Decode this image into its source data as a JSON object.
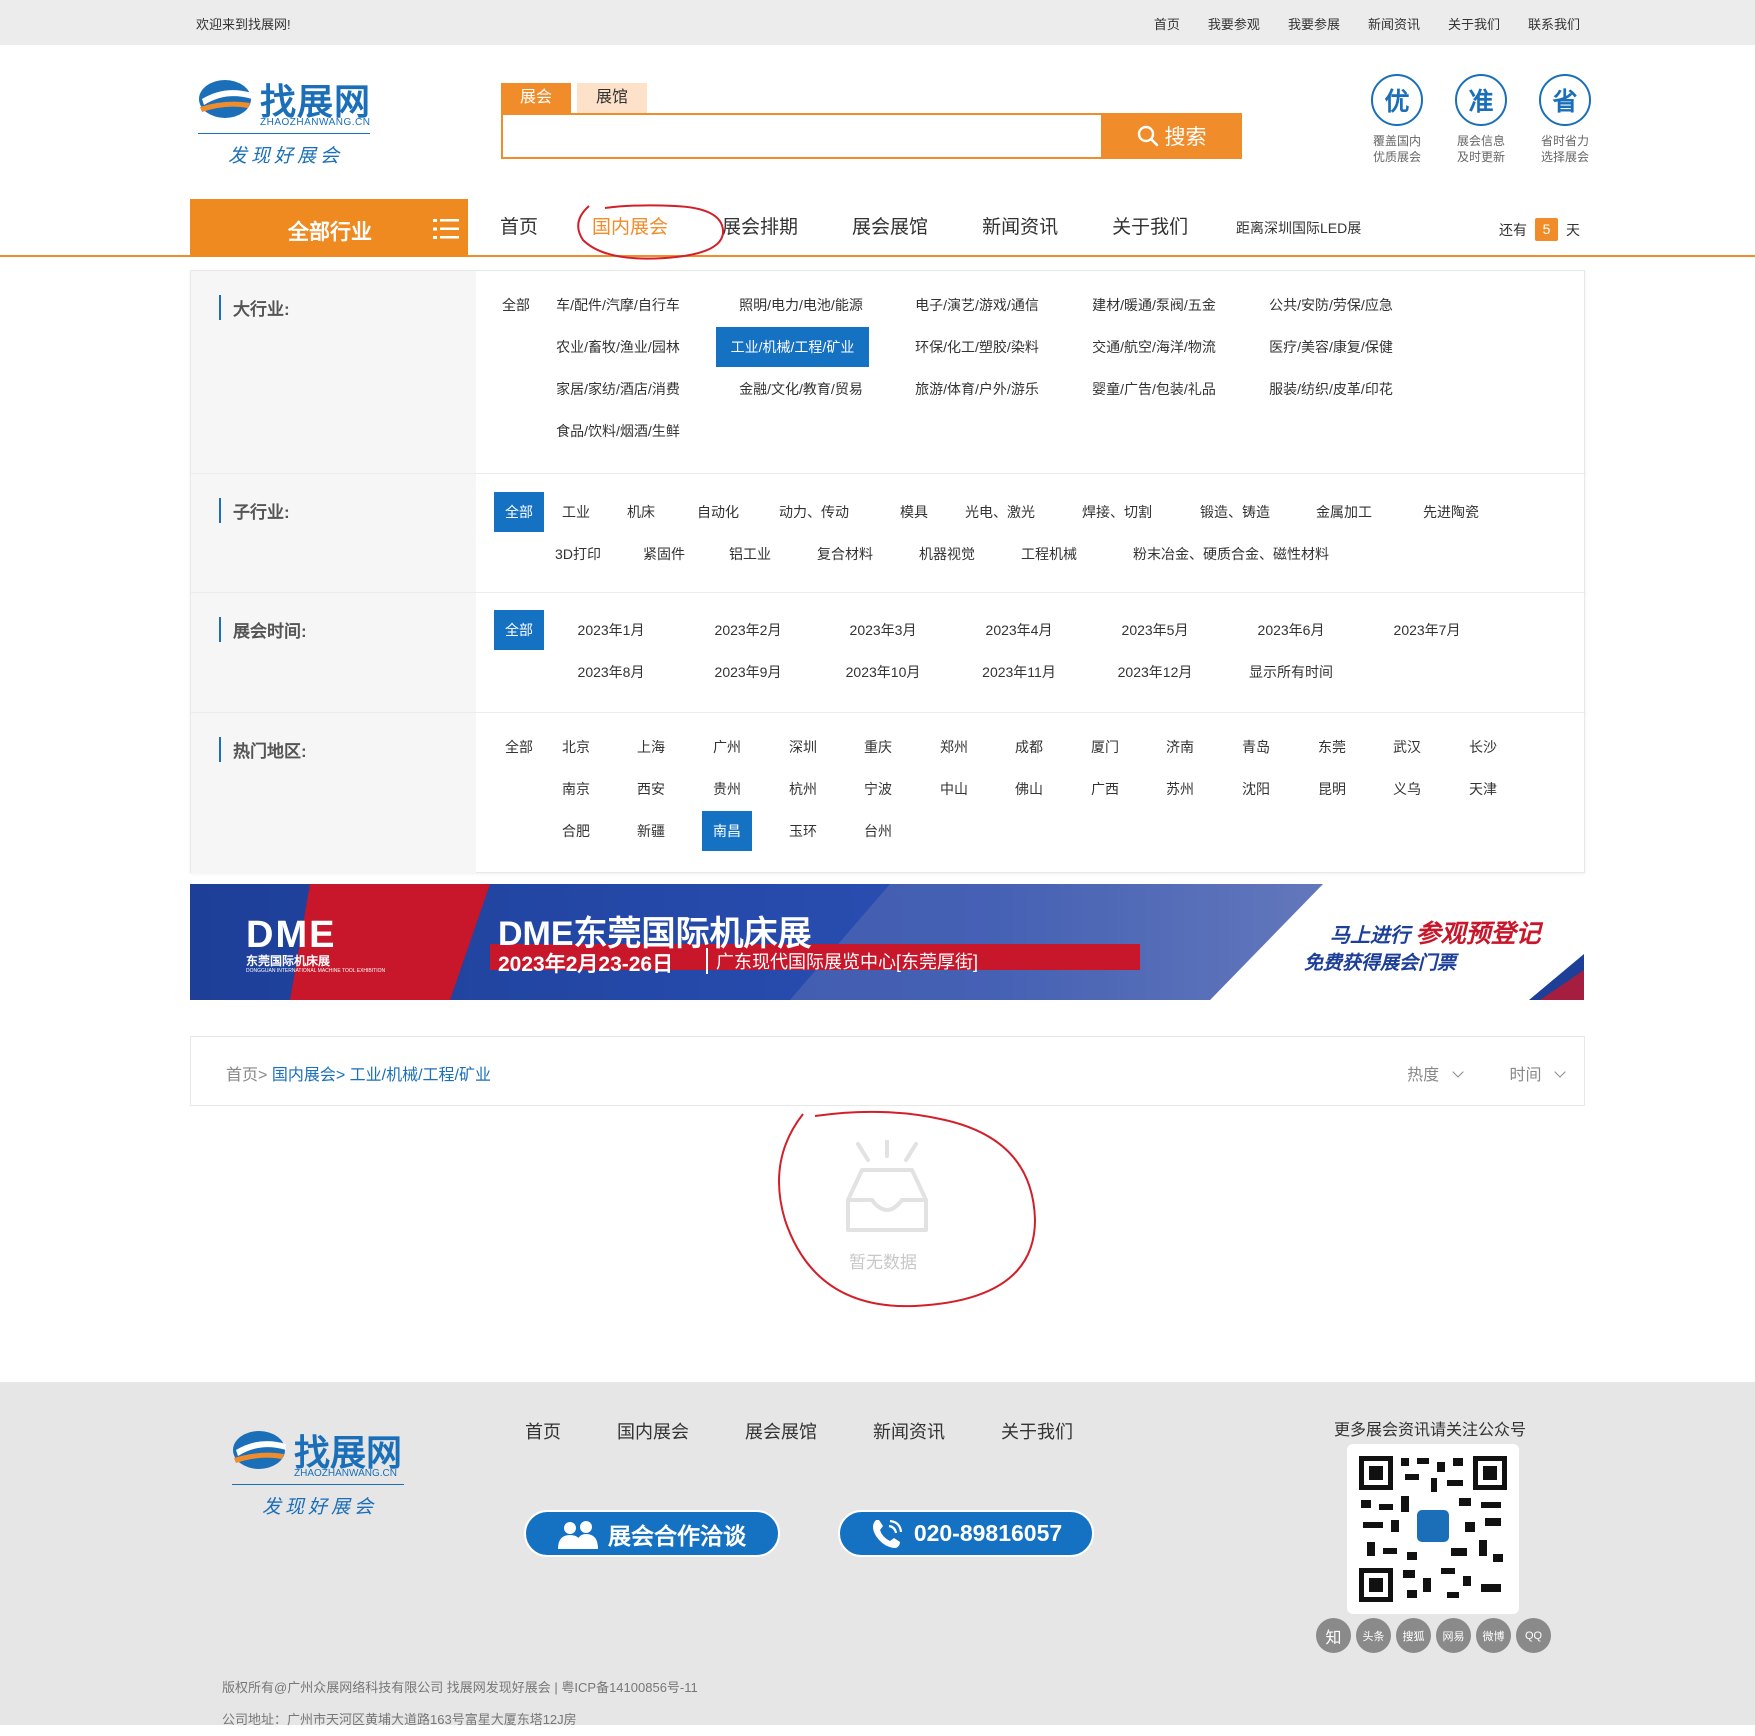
{
  "topbar": {
    "welcome": "欢迎来到找展网!",
    "links": [
      "首页",
      "我要参观",
      "我要参展",
      "新闻资讯",
      "关于我们",
      "联系我们"
    ]
  },
  "logo": {
    "name": "找展网",
    "pinyin": "ZHAOZHANWANG.CN",
    "slogan": "发现好展会"
  },
  "search": {
    "tab_active": "展会",
    "tab_other": "展馆",
    "value": "",
    "button": "搜索"
  },
  "badges": [
    {
      "char": "优",
      "text1": "覆盖国内",
      "text2": "优质展会"
    },
    {
      "char": "准",
      "text1": "展会信息",
      "text2": "及时更新"
    },
    {
      "char": "省",
      "text1": "省时省力",
      "text2": "选择展会"
    }
  ],
  "nav": {
    "all_industry": "全部行业",
    "items": [
      "首页",
      "国内展会",
      "展会排期",
      "展会展馆",
      "新闻资讯",
      "关于我们"
    ],
    "countdown": "距离深圳国际LED展",
    "remain_pre": "还有",
    "remain_num": "5",
    "remain_post": "天"
  },
  "filters": {
    "big_label": "大行业:",
    "big": [
      "全部",
      "车/配件/汽摩/自行车",
      "照明/电力/电池/能源",
      "电子/演艺/游戏/通信",
      "建材/暖通/泵阀/五金",
      "公共/安防/劳保/应急",
      "农业/畜牧/渔业/园林",
      "工业/机械/工程/矿业",
      "环保/化工/塑胶/染料",
      "交通/航空/海洋/物流",
      "医疗/美容/康复/保健",
      "家居/家纺/酒店/消费",
      "金融/文化/教育/贸易",
      "旅游/体育/户外/游乐",
      "婴童/广告/包装/礼品",
      "服装/纺织/皮革/印花",
      "食品/饮料/烟酒/生鲜"
    ],
    "sub_label": "子行业:",
    "sub": [
      "全部",
      "工业",
      "机床",
      "自动化",
      "动力、传动",
      "模具",
      "光电、激光",
      "焊接、切割",
      "锻造、铸造",
      "金属加工",
      "先进陶瓷",
      "3D打印",
      "紧固件",
      "铝工业",
      "复合材料",
      "机器视觉",
      "工程机械",
      "粉末冶金、硬质合金、磁性材料"
    ],
    "time_label": "展会时间:",
    "time": [
      "全部",
      "2023年1月",
      "2023年2月",
      "2023年3月",
      "2023年4月",
      "2023年5月",
      "2023年6月",
      "2023年7月",
      "2023年8月",
      "2023年9月",
      "2023年10月",
      "2023年11月",
      "2023年12月",
      "显示所有时间"
    ],
    "region_label": "热门地区:",
    "region": [
      "全部",
      "北京",
      "上海",
      "广州",
      "深圳",
      "重庆",
      "郑州",
      "成都",
      "厦门",
      "济南",
      "青岛",
      "东莞",
      "武汉",
      "长沙",
      "南京",
      "西安",
      "贵州",
      "杭州",
      "宁波",
      "中山",
      "佛山",
      "广西",
      "苏州",
      "沈阳",
      "昆明",
      "义乌",
      "天津",
      "合肥",
      "新疆",
      "南昌",
      "玉环",
      "台州"
    ]
  },
  "banner": {
    "logo": "DME",
    "logo_sub": "东莞国际机床展",
    "logo_en": "DONGGUAN INTERNATIONAL MACHINE TOOL EXHIBITION",
    "title": "DME东莞国际机床展",
    "date": "2023年2月23-26日",
    "venue": "广东现代国际展览中心[东莞厚街]",
    "cta1": "马上进行",
    "cta2": "参观预登记",
    "cta3": "免费获得展会门票"
  },
  "breadcrumb": {
    "home": "首页>",
    "domestic": "国内展会>",
    "current": "工业/机械/工程/矿业",
    "sort_hot": "热度",
    "sort_time": "时间"
  },
  "empty": {
    "message": "暂无数据"
  },
  "footer": {
    "nav": [
      "首页",
      "国内展会",
      "展会展馆",
      "新闻资讯",
      "关于我们"
    ],
    "coop": "展会合作洽谈",
    "phone": "020-89816057",
    "qr_title": "更多展会资讯请关注公众号",
    "socials": [
      "知",
      "头条",
      "搜狐",
      "网易",
      "微博",
      "QQ"
    ],
    "copyright": "版权所有@广州众展网络科技有限公司 找展网发现好展会 | 粤ICP备14100856号-11",
    "address": "公司地址：广州市天河区黄埔大道路163号富星大厦东塔12J房"
  },
  "colors": {
    "orange": "#f18c2a",
    "blue": "#1571c2",
    "annotation": "#d2202a"
  }
}
